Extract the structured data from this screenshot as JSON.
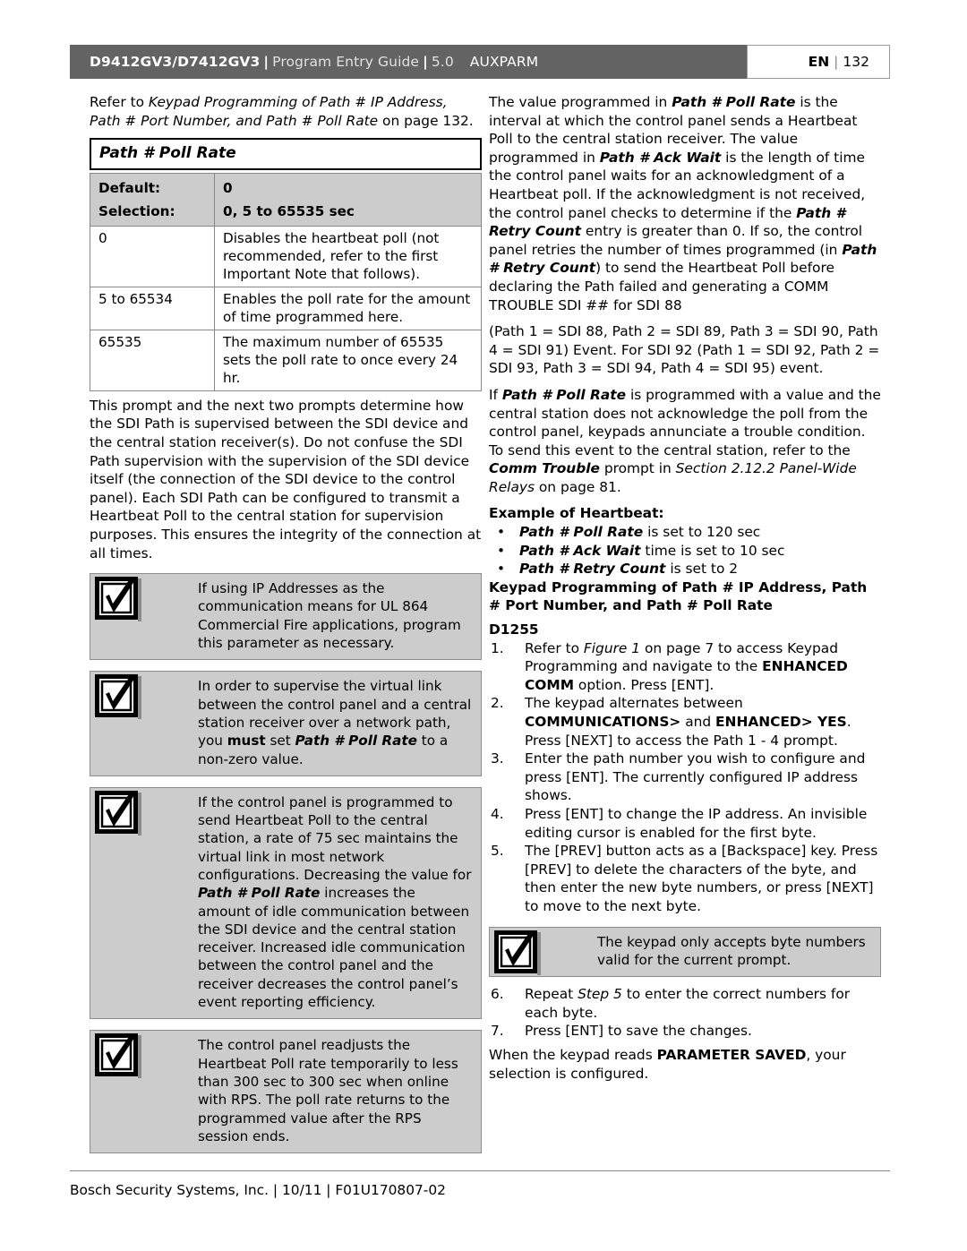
{
  "header": {
    "model": "D9412GV3/D7412GV3",
    "separator": "|",
    "guide": "Program Entry Guide",
    "version": "5.0",
    "section": "AUXPARM",
    "lang": "EN",
    "page_number": "132",
    "bg_color": "#636363"
  },
  "left_column": {
    "intro": {
      "lead": "Refer to ",
      "italic_ref": "Keypad Programming of Path # IP Address, Path # Port Number, and Path # Poll Rate",
      "tail": " on page 132."
    },
    "title_box": "Path # Poll Rate",
    "spec_table": {
      "default_label": "Default:",
      "default_value": "0",
      "selection_label": "Selection:",
      "selection_value": "0, 5 to 65535 sec",
      "rows": [
        {
          "key": "0",
          "desc": "Disables the heartbeat poll (not recommended, refer to the first Important Note that follows)."
        },
        {
          "key": "5 to 65534",
          "desc": "Enables the poll rate for the amount of time programmed here."
        },
        {
          "key": "65535",
          "desc": "The maximum number of 65535 sets the poll rate to once every 24 hr."
        }
      ]
    },
    "body_paragraph": "This prompt and the next two prompts determine how the SDI Path is supervised between the SDI device and the central station receiver(s). Do not confuse the SDI Path supervision with the supervision of the SDI device itself (the connection of the SDI device to the control panel). Each SDI Path can be configured to transmit a Heartbeat Poll to the central station for supervision purposes. This ensures the integrity of the connection at all times.",
    "notes": [
      {
        "icon": "checkbox-check-icon",
        "text": "If using IP Addresses as the communication means for UL 864 Commercial Fire applications, program this parameter as necessary."
      },
      {
        "icon": "checkbox-check-icon",
        "part1": "In order to supervise the virtual link between the control panel and a central station receiver over a network path, you ",
        "bold1": "must",
        "part2": " set ",
        "bolditalic1": "Path # Poll Rate",
        "part3": " to a non-zero value."
      },
      {
        "icon": "checkbox-check-icon",
        "part1": "If the control panel is programmed to send Heartbeat Poll to the central station, a rate of 75 sec maintains the virtual link in most network configurations. Decreasing the value for ",
        "bolditalic1": "Path # Poll Rate",
        "part2": " increases the amount of idle communication between the SDI device and the central station receiver. Increased idle communication between the control panel and the receiver decreases the control panel’s event reporting efficiency."
      },
      {
        "icon": "checkbox-check-icon",
        "text": "The control panel readjusts the Heartbeat Poll rate temporarily to less than 300 sec to 300 sec when online with RPS. The poll rate returns to the programmed value after the RPS session ends."
      }
    ]
  },
  "right_column": {
    "para1": {
      "p1": "The value programmed in ",
      "bi1": "Path # Poll Rate",
      "p2": " is the interval at which the control panel sends a Heartbeat Poll to the central station receiver. The value programmed in ",
      "bi2": "Path # Ack Wait",
      "p3": " is the length of time the control panel waits for an acknowledgment of a Heartbeat poll. If the acknowledgment is not received, the control panel checks to determine if the ",
      "bi3": "Path # Retry Count",
      "p4": " entry is greater than 0. If so, the control panel retries the number of times programmed (in ",
      "bi4": "Path # Retry Count",
      "p5": ") to send the Heartbeat Poll before declaring the Path failed and generating a COMM TROUBLE SDI ## for SDI 88"
    },
    "para2": "(Path 1 = SDI 88, Path 2 = SDI 89, Path 3 = SDI 90, Path 4 = SDI 91) Event. For SDI 92 (Path 1 = SDI 92, Path 2 = SDI 93, Path 3 = SDI 94, Path 4 = SDI 95) event.",
    "para3": {
      "p1": "If ",
      "bi1": "Path # Poll Rate",
      "p2": " is programmed with a value and the central station does not acknowledge the poll from the control panel, keypads annunciate a trouble condition. To send this event to the central station, refer to the ",
      "bi2": "Comm Trouble",
      "p3": " prompt in ",
      "i1": "Section 2.12.2 Panel-Wide Relays",
      "p4": " on page 81."
    },
    "example_heading": "Example of Heartbeat:",
    "bullets": [
      {
        "mark": "•",
        "bi": "Path # Poll Rate",
        "rest": " is set to 120 sec"
      },
      {
        "mark": "•",
        "bi": "Path # Ack Wait",
        "rest": " time is set to 10 sec"
      },
      {
        "mark": "•",
        "bi": "Path # Retry Count",
        "rest": " is set to 2"
      }
    ],
    "keypad_heading": "Keypad Programming of Path # IP Address, Path # Port Number, and Path # Poll Rate",
    "device_model": "D1255",
    "steps": [
      {
        "num": "1.",
        "p1": "Refer to ",
        "i1": "Figure 1",
        "p2": " on page 7 to access Keypad Programming and navigate to the ",
        "b1": "ENHANCED COMM",
        "p3": " option. Press [ENT]."
      },
      {
        "num": "2.",
        "p1": "The keypad alternates between ",
        "b1": "COMMUNICATIONS>",
        "p2": " and ",
        "b2": "ENHANCED> YES",
        "p3": ". Press [NEXT] to access the Path 1 - 4 prompt."
      },
      {
        "num": "3.",
        "p1": "Enter the path number you wish to configure and press [ENT]. The currently configured IP address shows."
      },
      {
        "num": "4.",
        "p1": "Press [ENT] to change the IP address. An invisible editing cursor is enabled for the first byte."
      },
      {
        "num": "5.",
        "p1": "The [PREV] button acts as a [Backspace] key. Press [PREV] to delete the characters of the byte, and then enter the new byte numbers, or press [NEXT] to move to the next byte."
      }
    ],
    "note": {
      "icon": "checkbox-check-icon",
      "text": "The keypad only accepts byte numbers valid for the current prompt."
    },
    "steps_after": [
      {
        "num": "6.",
        "p1": "Repeat ",
        "i1": "Step 5",
        "p2": " to enter the correct numbers for each byte."
      },
      {
        "num": "7.",
        "p1": "Press [ENT] to save the changes."
      }
    ],
    "closing": {
      "p1": "When the keypad reads ",
      "b1": "PARAMETER SAVED",
      "p2": ", your selection is configured."
    }
  },
  "footer": {
    "text": "Bosch Security Systems, Inc. | 10/11 | F01U170807-02"
  }
}
